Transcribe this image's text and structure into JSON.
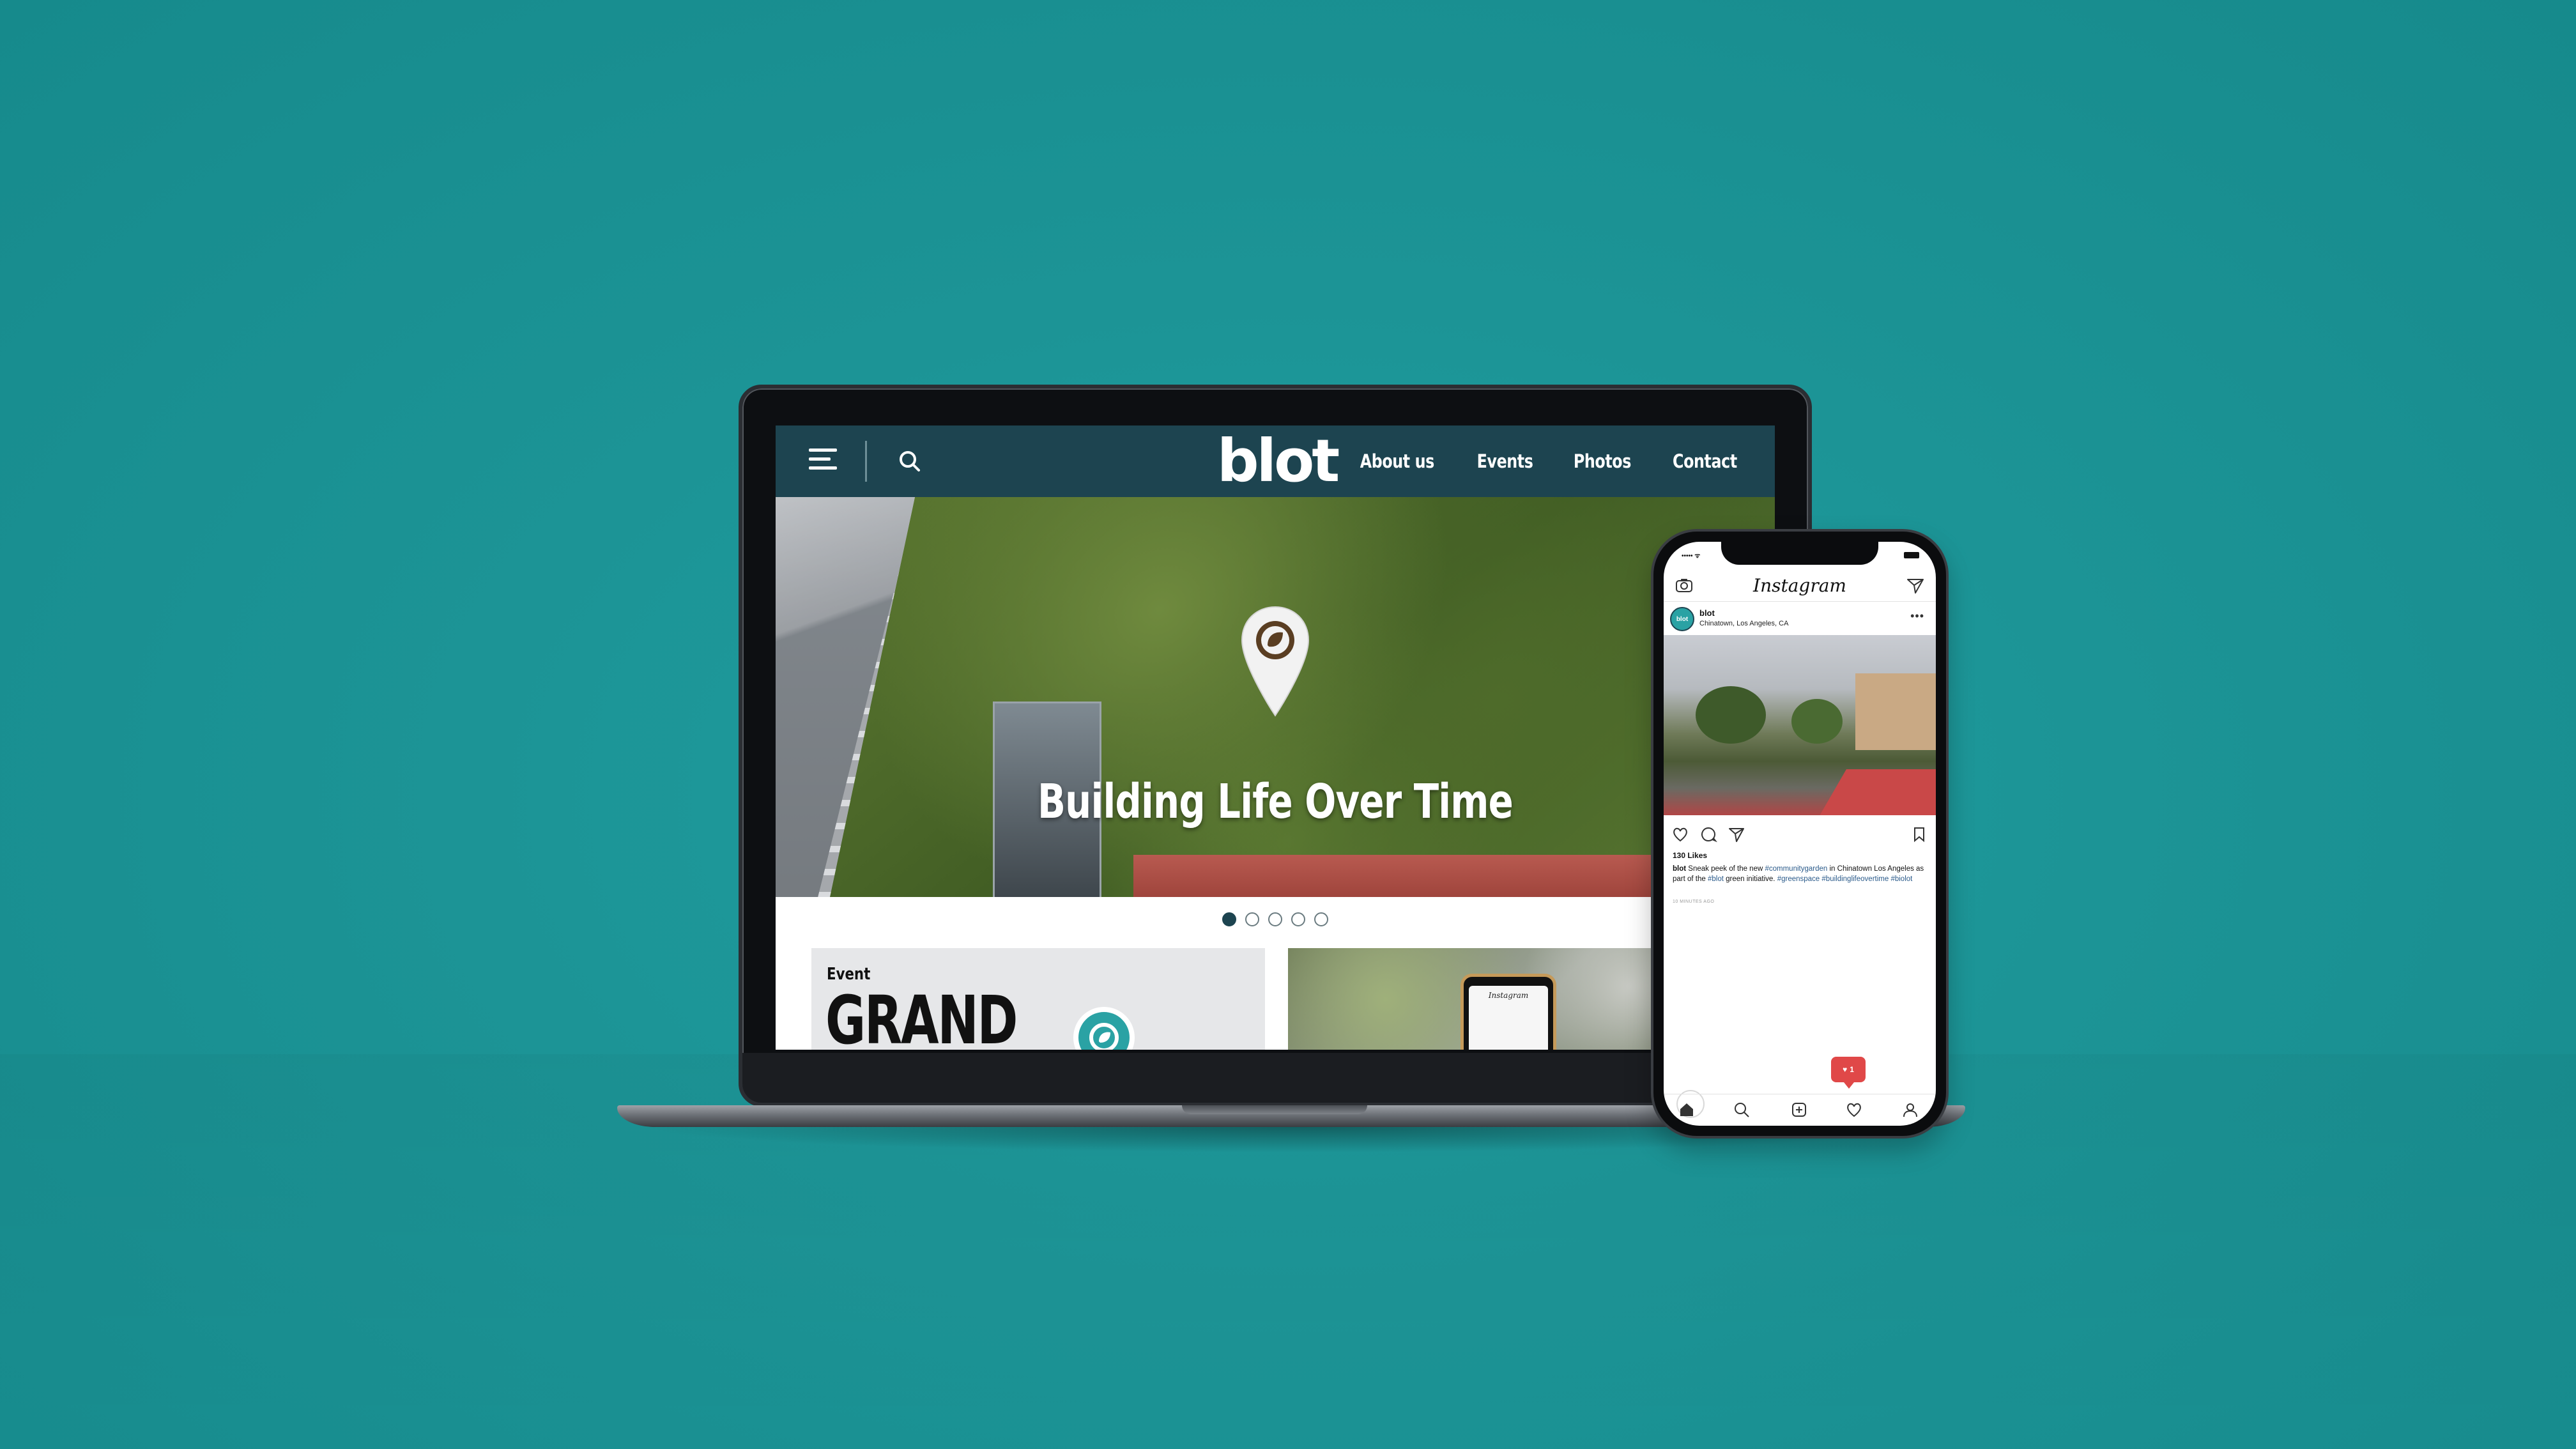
{
  "website": {
    "logo": "blot",
    "nav": {
      "links": [
        "About us",
        "Events",
        "Photos",
        "Contact"
      ]
    },
    "hero": {
      "title": "Building Life Over Time"
    },
    "carousel": {
      "slides": 5,
      "active": 1
    },
    "event_card": {
      "label": "Event",
      "title": "GRAND"
    },
    "photo_card": {
      "phone_app_title": "Instagram"
    }
  },
  "phone": {
    "status_bar": {
      "signal": "••••• ᯤ"
    },
    "instagram": {
      "wordmark": "Instagram",
      "post": {
        "avatar_text": "blot",
        "username": "blot",
        "location": "Chinatown, Los Angeles, CA",
        "likes": "130 Likes",
        "caption_user": "blot",
        "caption_part1": "Sneak peek of the new",
        "tag1": "#communitygarden",
        "caption_part2": "in Chinatown Los Angeles as part of the",
        "tag2": "#blot",
        "caption_part3": "green initiative.",
        "tag3": "#greenspace",
        "tag4": "#buildinglifeovertime",
        "tag5": "#biolot",
        "timestamp": "10 MINUTES AGO"
      },
      "notification": {
        "count": "1"
      }
    }
  },
  "colors": {
    "background": "#1c9496",
    "nav_bar": "#1d4450",
    "brand_teal": "#2aa2a4",
    "notification_red": "#e04848"
  }
}
